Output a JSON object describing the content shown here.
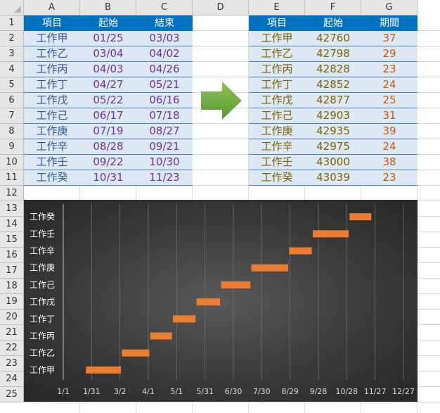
{
  "column_headers": [
    "A",
    "B",
    "C",
    "D",
    "E",
    "F",
    "G"
  ],
  "row_numbers": [
    "1",
    "2",
    "3",
    "4",
    "5",
    "6",
    "7",
    "8",
    "9",
    "10",
    "11",
    "12",
    "13",
    "14",
    "15",
    "16",
    "17",
    "18",
    "19",
    "20",
    "21",
    "22",
    "23",
    "24",
    "25"
  ],
  "left_table": {
    "headers": [
      "項目",
      "起始",
      "結束"
    ],
    "rows": [
      [
        "工作甲",
        "01/25",
        "03/03"
      ],
      [
        "工作乙",
        "03/04",
        "04/02"
      ],
      [
        "工作丙",
        "04/03",
        "04/26"
      ],
      [
        "工作丁",
        "04/27",
        "05/21"
      ],
      [
        "工作戊",
        "05/22",
        "06/16"
      ],
      [
        "工作己",
        "06/17",
        "07/18"
      ],
      [
        "工作庚",
        "07/19",
        "08/27"
      ],
      [
        "工作辛",
        "08/28",
        "09/21"
      ],
      [
        "工作壬",
        "09/22",
        "10/30"
      ],
      [
        "工作癸",
        "10/31",
        "11/23"
      ]
    ]
  },
  "right_table": {
    "headers": [
      "項目",
      "起始",
      "期間"
    ],
    "rows": [
      [
        "工作甲",
        "42760",
        "37"
      ],
      [
        "工作乙",
        "42798",
        "29"
      ],
      [
        "工作丙",
        "42828",
        "23"
      ],
      [
        "工作丁",
        "42852",
        "24"
      ],
      [
        "工作戊",
        "42877",
        "25"
      ],
      [
        "工作己",
        "42903",
        "31"
      ],
      [
        "工作庚",
        "42935",
        "39"
      ],
      [
        "工作辛",
        "42975",
        "24"
      ],
      [
        "工作壬",
        "43000",
        "38"
      ],
      [
        "工作癸",
        "43039",
        "23"
      ]
    ]
  },
  "arrow_icon": "right-arrow-icon",
  "colors": {
    "header_fill": "#0070c0",
    "row_fill": "#dce9f5",
    "arrow": "#6aa84f",
    "bar": "#ed7d31"
  },
  "chart_data": {
    "type": "bar",
    "orientation": "horizontal-floating",
    "categories": [
      "工作甲",
      "工作乙",
      "工作丙",
      "工作丁",
      "工作戊",
      "工作己",
      "工作庚",
      "工作辛",
      "工作壬",
      "工作癸"
    ],
    "start_serial": [
      42760,
      42798,
      42828,
      42852,
      42877,
      42903,
      42935,
      42975,
      43000,
      43039
    ],
    "duration_days": [
      37,
      29,
      23,
      24,
      25,
      31,
      39,
      24,
      38,
      23
    ],
    "x_ticks": [
      "1/1",
      "1/31",
      "3/2",
      "4/1",
      "5/1",
      "5/31",
      "6/30",
      "7/30",
      "8/29",
      "9/28",
      "10/28",
      "11/27",
      "12/27"
    ],
    "x_tick_serials": [
      42736,
      42766,
      42796,
      42826,
      42856,
      42886,
      42916,
      42946,
      42976,
      43006,
      43036,
      43066,
      43096
    ],
    "xlim": [
      42736,
      43096
    ],
    "grid": true,
    "legend": "none"
  }
}
